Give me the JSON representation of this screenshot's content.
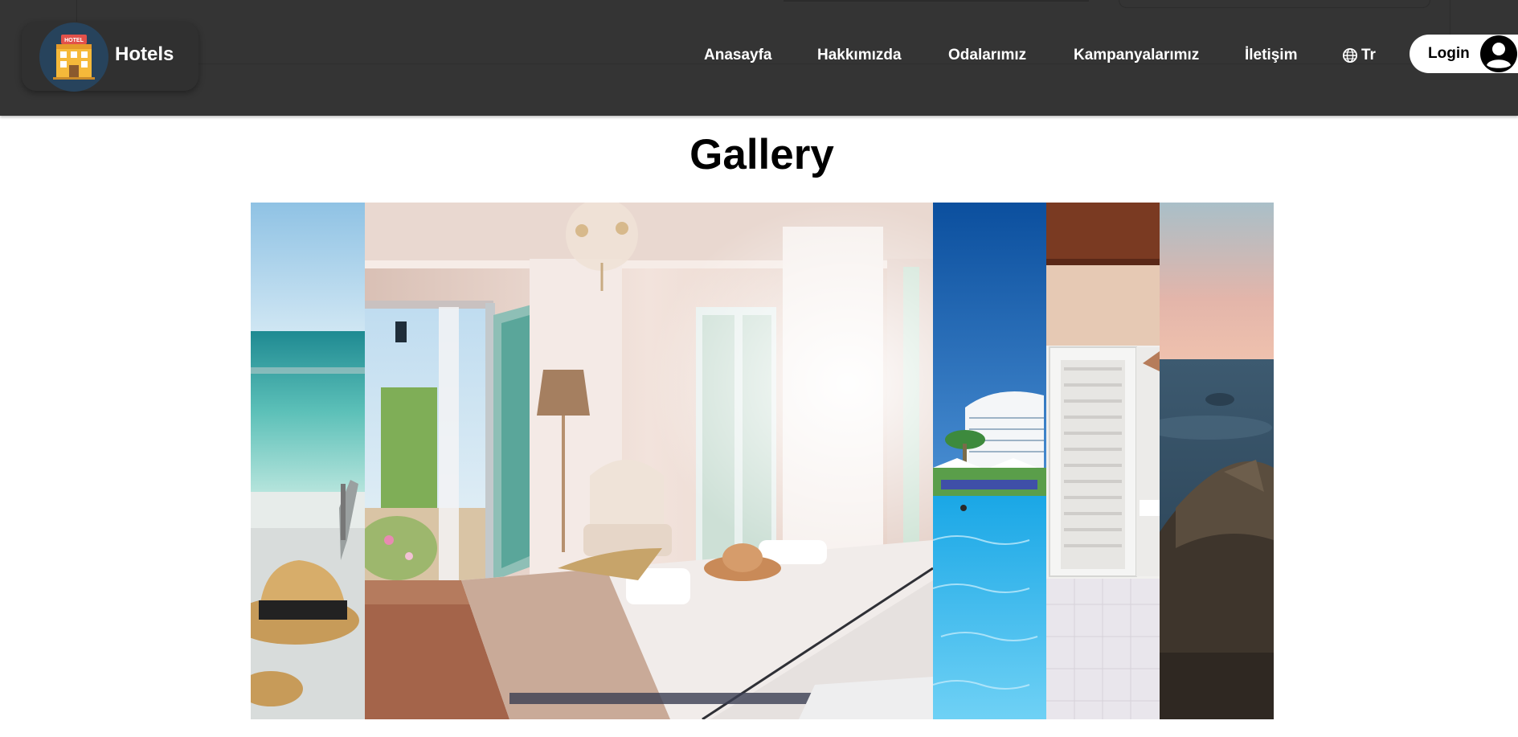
{
  "header": {
    "brand_name": "Hotels",
    "logo_icon": "hotel-building-icon",
    "logo_sign": "HOTEL",
    "nav": [
      "Anasayfa",
      "Hakkımızda",
      "Odalarımız",
      "Kampanyalarımız",
      "İletişim"
    ],
    "language": "Tr",
    "language_icon": "globe-icon",
    "login_label": "Login",
    "login_icon": "user-avatar-icon"
  },
  "gallery": {
    "title": "Gallery",
    "panels": [
      "beach-sea-with-straw-hat",
      "bedroom-with-chandelier-and-balcony",
      "resort-pool-and-hotel-tower",
      "white-wardrobe-room",
      "sunset-sea-view-with-beanbag"
    ]
  },
  "colors": {
    "navbar_bg": "#343434",
    "logo_circle": "#27435c",
    "text_light": "#ffffff"
  }
}
